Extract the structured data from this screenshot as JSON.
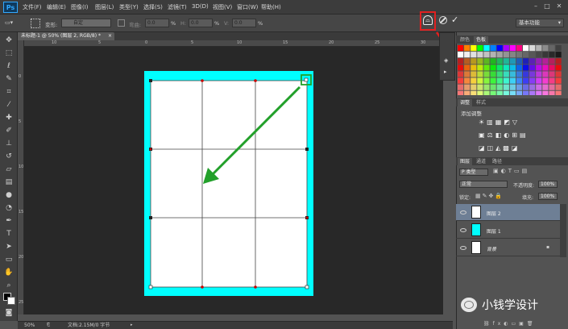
{
  "app": {
    "logo": "Ps"
  },
  "menu": [
    "文件(F)",
    "编辑(E)",
    "图像(I)",
    "图层(L)",
    "类型(Y)",
    "选择(S)",
    "滤镜(T)",
    "3D(D)",
    "视图(V)",
    "窗口(W)",
    "帮助(H)"
  ],
  "options": {
    "mode_label": "变形:",
    "mode_value": "自定",
    "bend_label": "弯曲:",
    "bend_value": "0.0",
    "h_label": "H:",
    "h_value": "0.0",
    "v_label": "V:",
    "v_value": "0.0",
    "percent": "%",
    "workspace": "基本功能"
  },
  "document": {
    "tab_title": "未标题-1 @ 50% (图层 2, RGB/8) *",
    "zoom": "50%",
    "doc_info": "文档:2.15M/0 字节"
  },
  "rulers": {
    "h_ticks": [
      "10",
      "5",
      "0",
      "5",
      "10",
      "15",
      "20",
      "25",
      "30",
      "35"
    ],
    "v_ticks": [
      "0",
      "5",
      "10",
      "15",
      "20",
      "25"
    ]
  },
  "panels": {
    "color_tabs": [
      "颜色",
      "色板"
    ],
    "adjust_tabs": [
      "调整",
      "样式"
    ],
    "adjust_title": "添加调整",
    "layers_tabs": [
      "图层",
      "通道",
      "路径"
    ],
    "kind_filter": "P 类型",
    "blend_mode": "正常",
    "opacity_label": "不透明度:",
    "opacity_value": "100%",
    "lock_label": "锁定:",
    "fill_label": "填充:",
    "fill_value": "100%",
    "layers": [
      {
        "name": "图层 2",
        "thumb_color": "#ffffff",
        "selected": true,
        "locked": false
      },
      {
        "name": "图层 1",
        "thumb_color": "#00ffff",
        "selected": false,
        "locked": false
      },
      {
        "name": "背景",
        "thumb_color": "#ffffff",
        "selected": false,
        "locked": true
      }
    ]
  },
  "watermark": {
    "text": "小钱学设计"
  },
  "colors": {
    "canvas_fill": "#00ffff",
    "highlight": "#e02020",
    "arrow": "#22a02a",
    "handle_red": "#cc0000"
  }
}
